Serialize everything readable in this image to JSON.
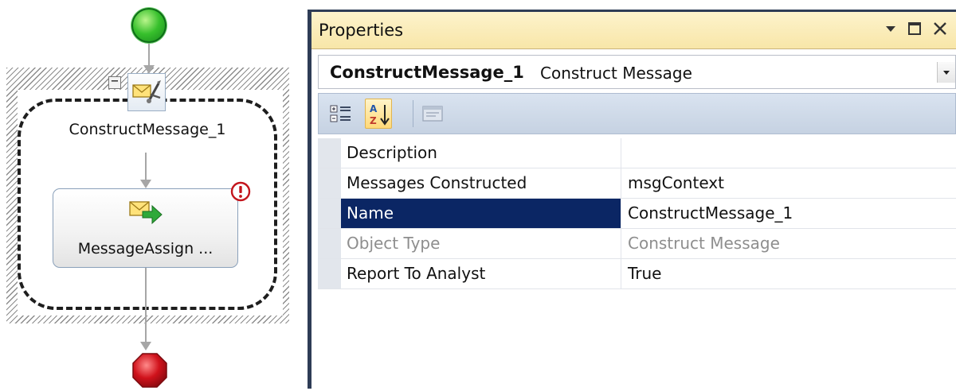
{
  "designer": {
    "scope_label": "ConstructMessage_1",
    "shape_label": "MessageAssign ...",
    "collapse_glyph": "−",
    "icons": {
      "start": "start-circle-icon",
      "construct": "construct-message-icon",
      "assign": "message-assignment-icon",
      "error": "error-badge-icon",
      "stop": "stop-octagon-icon"
    }
  },
  "properties": {
    "title": "Properties",
    "object_name": "ConstructMessage_1",
    "object_type": "Construct Message",
    "toolbar": [
      "categorized-icon",
      "alphabetical-icon",
      "property-pages-icon"
    ],
    "rows": [
      {
        "key": "Description",
        "value": ""
      },
      {
        "key": "Messages Constructed",
        "value": "msgContext"
      },
      {
        "key": "Name",
        "value": "ConstructMessage_1"
      },
      {
        "key": "Object Type",
        "value": "Construct Message"
      },
      {
        "key": "Report To Analyst",
        "value": "True"
      }
    ]
  },
  "colors": {
    "title_bar": "#f8e6a8",
    "selection": "#0b2664",
    "window_frame": "#2e3c56",
    "start_green": "#37c02c",
    "stop_red": "#d0121b"
  }
}
